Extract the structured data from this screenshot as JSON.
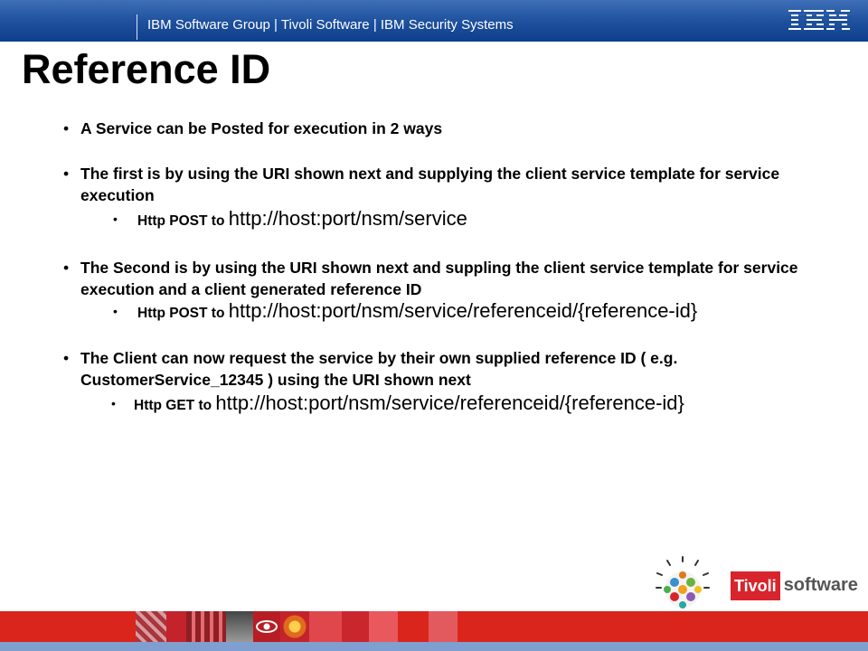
{
  "header": {
    "banner": "IBM Software Group | Tivoli Software | IBM Security Systems",
    "logo": "IBM",
    "colors": {
      "bar": "#1c4f9c",
      "text": "#ffffff"
    }
  },
  "slide": {
    "title": "Reference ID",
    "bullets": [
      {
        "text": " A Service can be Posted for execution in 2 ways"
      },
      {
        "text": " The first is by using the URI shown next and supplying the client service template for service execution",
        "sub": {
          "method": " Http POST to ",
          "uri": "http://host:port/nsm/service"
        }
      },
      {
        "text": " The Second is by using the URI shown next and suppling the client service template for service execution and a client generated reference ID",
        "sub": {
          "method": " Http POST to ",
          "uri": "http://host:port/nsm/service/referenceid/{reference-id}"
        }
      },
      {
        "text": " The Client can now request the service by their own supplied reference ID ( e.g. CustomerService_12345  ) using the URI shown next",
        "sub": {
          "method": "Http GET to ",
          "uri": "http://host:port/nsm/service/referenceid/{reference-id}"
        }
      }
    ]
  },
  "branding": {
    "tivoli_box": "Tivoli",
    "tivoli_word": "software",
    "icon": "ibm-smarter-planet-icon",
    "colors": {
      "tivoli_red": "#d8242c",
      "footer": "#d9251c",
      "footer_band": "#7f9fd1"
    }
  }
}
